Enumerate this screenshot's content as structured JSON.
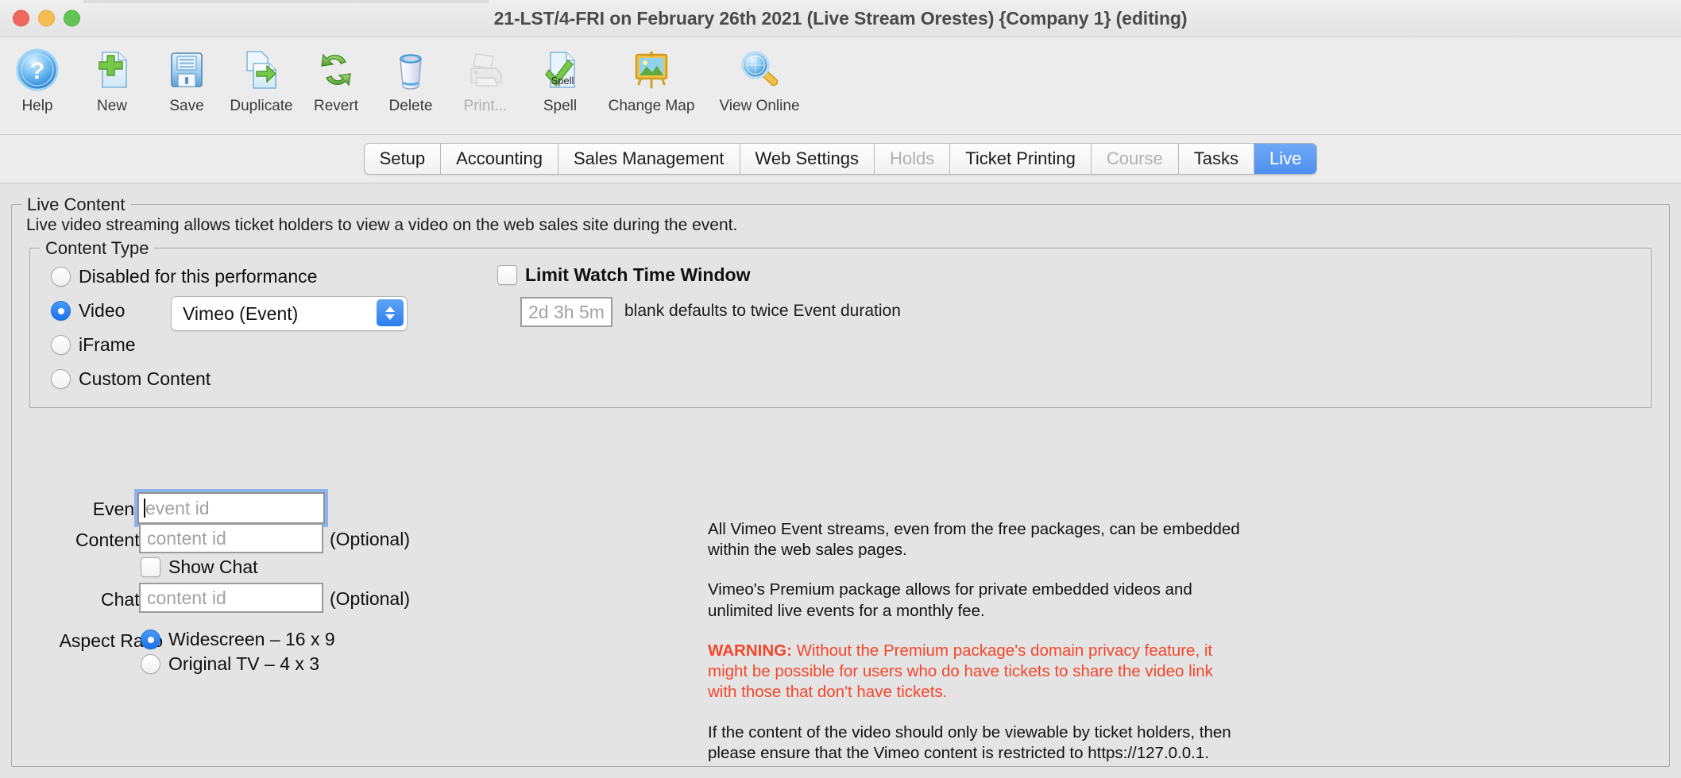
{
  "window": {
    "title": "21-LST/4-FRI on February 26th 2021 (Live Stream Orestes) {Company 1} (editing)",
    "traffic_lights": [
      "close",
      "minimize",
      "maximize"
    ]
  },
  "toolbar": {
    "items": [
      {
        "label": "Help",
        "icon": "help-icon",
        "disabled": false
      },
      {
        "label": "New",
        "icon": "new-icon",
        "disabled": false
      },
      {
        "label": "Save",
        "icon": "save-icon",
        "disabled": false
      },
      {
        "label": "Duplicate",
        "icon": "duplicate-icon",
        "disabled": false
      },
      {
        "label": "Revert",
        "icon": "revert-icon",
        "disabled": false
      },
      {
        "label": "Delete",
        "icon": "delete-icon",
        "disabled": false
      },
      {
        "label": "Print...",
        "icon": "print-icon",
        "disabled": true
      },
      {
        "label": "Spell",
        "icon": "spell-icon",
        "disabled": false
      },
      {
        "label": "Change Map",
        "icon": "change-map-icon",
        "disabled": false
      },
      {
        "label": "View Online",
        "icon": "view-online-icon",
        "disabled": false
      }
    ]
  },
  "tabs": [
    {
      "label": "Setup",
      "state": "normal"
    },
    {
      "label": "Accounting",
      "state": "normal"
    },
    {
      "label": "Sales Management",
      "state": "normal"
    },
    {
      "label": "Web Settings",
      "state": "normal"
    },
    {
      "label": "Holds",
      "state": "disabled"
    },
    {
      "label": "Ticket Printing",
      "state": "normal"
    },
    {
      "label": "Course",
      "state": "disabled"
    },
    {
      "label": "Tasks",
      "state": "normal"
    },
    {
      "label": "Live",
      "state": "active"
    }
  ],
  "live_content": {
    "group_title": "Live Content",
    "description": "Live video streaming allows ticket holders to view a video on the web sales site during the event."
  },
  "content_type": {
    "group_title": "Content Type",
    "options": [
      {
        "label": "Disabled for this performance",
        "selected": false
      },
      {
        "label": "Video",
        "selected": true
      },
      {
        "label": "iFrame",
        "selected": false
      },
      {
        "label": "Custom Content",
        "selected": false
      }
    ],
    "video_source": {
      "value": "Vimeo (Event)"
    },
    "limit_watch": {
      "label": "Limit Watch Time Window",
      "checked": false,
      "duration_placeholder": "2d 3h 5m",
      "hint": "blank defaults to twice Event duration"
    }
  },
  "form": {
    "event_id": {
      "label": "Event ID",
      "placeholder": "event id",
      "value": "",
      "focused": true
    },
    "content_id": {
      "label": "Content ID",
      "placeholder": "content id",
      "value": "",
      "suffix": "(Optional)"
    },
    "show_chat": {
      "label": "Show Chat",
      "checked": false
    },
    "chat_id": {
      "label": "Chat ID",
      "placeholder": "content id",
      "value": "",
      "suffix": "(Optional)"
    },
    "aspect_ratio": {
      "label": "Aspect Ratio",
      "options": [
        {
          "label": "Widescreen – 16 x 9",
          "selected": true
        },
        {
          "label": "Original TV – 4 x 3",
          "selected": false
        }
      ]
    }
  },
  "help": {
    "paragraph1": "All Vimeo Event streams, even from the free packages, can be embedded within the web sales pages.",
    "paragraph2": "Vimeo's Premium package allows for private embedded videos and unlimited live events for a monthly fee.",
    "warning_prefix": "WARNING:",
    "warning_body": " Without the Premium package's domain privacy feature, it might be possible for users who do have tickets to share the video link with those that don't have tickets.",
    "paragraph4": "If the content of the video should only be viewable by ticket holders, then please ensure that the Vimeo content is restricted to https://127.0.0.1."
  },
  "colors": {
    "accent": "#4f90ef",
    "warning": "#f4452a",
    "window_bg": "#e4e4e4",
    "chrome_bg": "#ececec"
  }
}
